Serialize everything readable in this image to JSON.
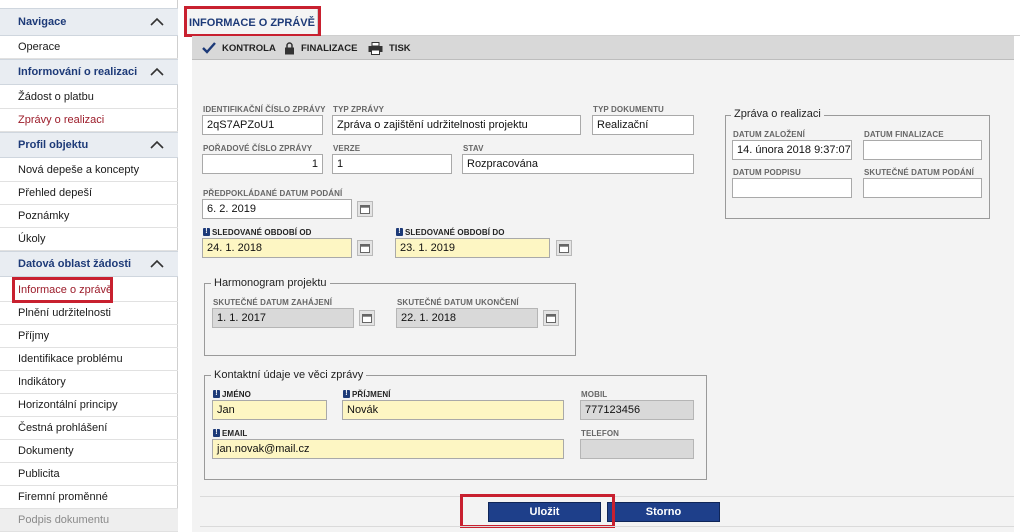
{
  "sidebar": {
    "sections": [
      {
        "title": "Navigace",
        "items": [
          "Operace"
        ]
      },
      {
        "title": "Informování o realizaci",
        "items": [
          "Žádost o platbu",
          "Zprávy o realizaci"
        ]
      },
      {
        "title": "Profil objektu",
        "items": [
          "Nová depeše a koncepty",
          "Přehled depeší",
          "Poznámky",
          "Úkoly"
        ]
      },
      {
        "title": "Datová oblast žádosti",
        "items": [
          "Informace o zprávě",
          "Plnění udržitelnosti",
          "Příjmy",
          "Identifikace problému",
          "Indikátory",
          "Horizontální principy",
          "Čestná prohlášení",
          "Dokumenty",
          "Publicita",
          "Firemní proměnné",
          "Podpis dokumentu"
        ]
      }
    ]
  },
  "tab": {
    "label": "INFORMACE O ZPRÁVĚ"
  },
  "toolbar": {
    "kontrola": "KONTROLA",
    "finalizace": "FINALIZACE",
    "tisk": "TISK"
  },
  "form": {
    "id_label": "IDENTIFIKAČNÍ ČÍSLO ZPRÁVY",
    "id_value": "2qS7APZoU1",
    "type_label": "TYP ZPRÁVY",
    "type_value": "Zpráva o zajištění udržitelnosti projektu",
    "doctype_label": "TYP DOKUMENTU",
    "doctype_value": "Realizační",
    "order_label": "POŘADOVÉ ČÍSLO ZPRÁVY",
    "order_value": "1",
    "version_label": "VERZE",
    "version_value": "1",
    "state_label": "STAV",
    "state_value": "Rozpracována",
    "planned_label": "PŘEDPOKLÁDANÉ DATUM PODÁNÍ",
    "planned_value": "6. 2. 2019",
    "period_from_label": "SLEDOVANÉ OBDOBÍ OD",
    "period_from_value": "24. 1. 2018",
    "period_to_label": "SLEDOVANÉ OBDOBÍ DO",
    "period_to_value": "23. 1. 2019"
  },
  "report_box": {
    "legend": "Zpráva o realizaci",
    "created_label": "DATUM ZALOŽENÍ",
    "created_value": "14. února 2018 9:37:07",
    "final_label": "DATUM FINALIZACE",
    "final_value": "",
    "sign_label": "DATUM PODPISU",
    "sign_value": "",
    "submit_label": "SKUTEČNÉ DATUM PODÁNÍ",
    "submit_value": ""
  },
  "harmonogram": {
    "legend": "Harmonogram projektu",
    "start_label": "SKUTEČNÉ DATUM ZAHÁJENÍ",
    "start_value": "1. 1. 2017",
    "end_label": "SKUTEČNÉ DATUM UKONČENÍ",
    "end_value": "22. 1. 2018"
  },
  "contact": {
    "legend": "Kontaktní údaje ve věci zprávy",
    "first_label": "JMÉNO",
    "first_value": "Jan",
    "last_label": "PŘÍJMENÍ",
    "last_value": "Novák",
    "mobile_label": "MOBIL",
    "mobile_value": "777123456",
    "email_label": "EMAIL",
    "email_value": "jan.novak@mail.cz",
    "phone_label": "TELEFON",
    "phone_value": ""
  },
  "actions": {
    "save": "Uložit",
    "cancel": "Storno"
  },
  "colors": {
    "accent": "#1e3f8a",
    "highlight": "#c8202f",
    "required_field": "#fdf6c3"
  }
}
